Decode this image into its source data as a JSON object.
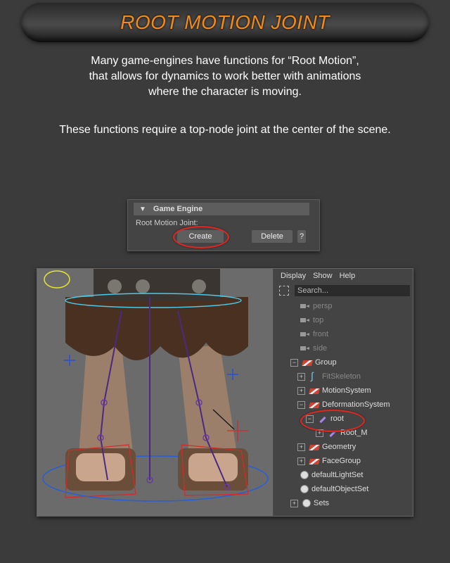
{
  "banner": {
    "title": "ROOT MOTION JOINT"
  },
  "intro": {
    "line1": "Many game-engines have functions for “Root Motion”,",
    "line2": "that allows for dynamics to work better with animations",
    "line3": "where the character is moving."
  },
  "note": "These functions require a top-node joint at the center of the scene.",
  "game_engine": {
    "header": "Game Engine",
    "label": "Root Motion Joint:",
    "create_label": "Create",
    "delete_label": "Delete",
    "help_label": "?"
  },
  "outliner": {
    "menu": [
      "Display",
      "Show",
      "Help"
    ],
    "search_placeholder": "Search...",
    "items": [
      {
        "label": "persp"
      },
      {
        "label": "top"
      },
      {
        "label": "front"
      },
      {
        "label": "side"
      },
      {
        "label": "Group"
      },
      {
        "label": "FitSkeleton"
      },
      {
        "label": "MotionSystem"
      },
      {
        "label": "DeformationSystem"
      },
      {
        "label": "root"
      },
      {
        "label": "Root_M"
      },
      {
        "label": "Geometry"
      },
      {
        "label": "FaceGroup"
      },
      {
        "label": "defaultLightSet"
      },
      {
        "label": "defaultObjectSet"
      },
      {
        "label": "Sets"
      }
    ]
  },
  "colors": {
    "accent": "#f08b1c",
    "highlight_ring": "#e2261f",
    "background": "#3b3b3b"
  }
}
